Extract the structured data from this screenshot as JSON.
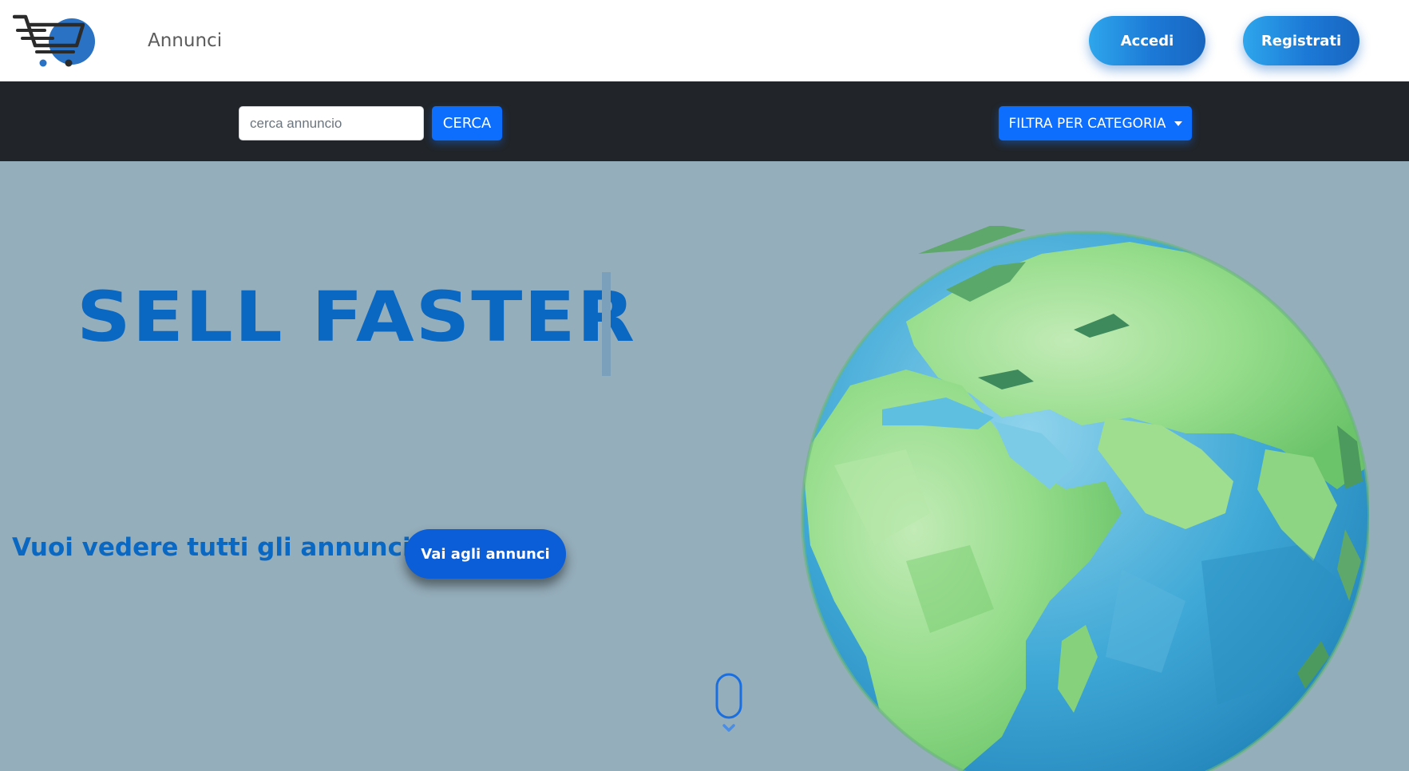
{
  "navbar": {
    "logo_icon": "shopping-cart-logo",
    "annunci_link": "Annunci",
    "login_label": "Accedi",
    "register_label": "Registrati"
  },
  "filterbar": {
    "search_placeholder": "cerca annuncio",
    "search_button": "CERCA",
    "category_dropdown": "FILTRA PER CATEGORIA"
  },
  "hero": {
    "title": "SELL FASTER",
    "cta_question": "Vuoi vedere tutti gli annunci?",
    "cta_button": "Vai agli annunci",
    "scroll_icon": "mouse-scroll-icon",
    "globe_image": "low-poly-earth-globe"
  },
  "colors": {
    "brand_blue": "#0a68c2",
    "primary": "#0d6efd",
    "hero_bg": "#95aebb",
    "dark_bar": "#212529"
  }
}
